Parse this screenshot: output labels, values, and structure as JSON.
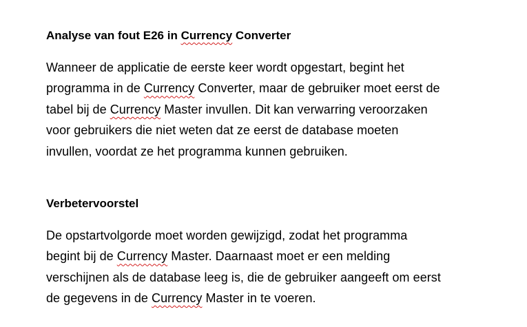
{
  "sections": [
    {
      "heading": {
        "before": "Analyse van fout E26 in ",
        "flagged": "Currency",
        "after": " Converter"
      },
      "lines": [
        {
          "before": "Wanneer de applicatie de eerste keer wordt opgestart, begint het",
          "flagged": "",
          "after": ""
        },
        {
          "before": "programma in de ",
          "flagged": "Currency",
          "after": " Converter, maar de gebruiker moet eerst de"
        },
        {
          "before": "tabel bij de ",
          "flagged": "Currency",
          "after": " Master invullen. Dit kan verwarring veroorzaken"
        },
        {
          "before": "voor gebruikers die niet weten dat ze eerst de database moeten",
          "flagged": "",
          "after": ""
        },
        {
          "before": "invullen, voordat ze het programma kunnen gebruiken.",
          "flagged": "",
          "after": ""
        }
      ]
    },
    {
      "heading": {
        "before": "Verbetervoorstel",
        "flagged": "",
        "after": ""
      },
      "lines": [
        {
          "before": "De opstartvolgorde moet worden gewijzigd, zodat het programma",
          "flagged": "",
          "after": ""
        },
        {
          "before": "begint bij de ",
          "flagged": "Currency",
          "after": " Master. Daarnaast moet er een melding"
        },
        {
          "before": "verschijnen als de database leeg is, die de gebruiker aangeeft om eerst",
          "flagged": "",
          "after": ""
        },
        {
          "before": "de gegevens in de ",
          "flagged": "Currency",
          "after": " Master in te voeren."
        }
      ]
    }
  ],
  "colors": {
    "text": "#000000",
    "spellcheck_underline": "#d42020",
    "background": "#ffffff"
  }
}
